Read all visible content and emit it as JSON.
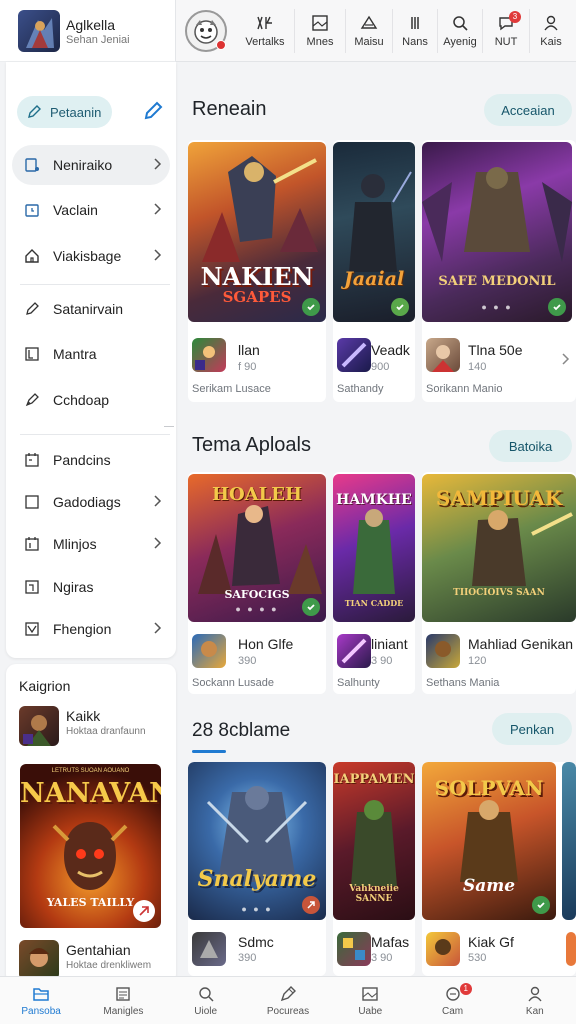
{
  "app": {
    "name": "Aglkella",
    "subtitle": "Sehan Jeniai"
  },
  "topbar": {
    "items": [
      {
        "label": "Vertalks",
        "icon": "bar-chart-icon"
      },
      {
        "label": "Mnes",
        "icon": "image-icon"
      },
      {
        "label": "Maisu",
        "icon": "triangle-icon"
      },
      {
        "label": "Nans",
        "icon": "columns-icon"
      },
      {
        "label": "Ayenig",
        "icon": "search-icon"
      },
      {
        "label": "NUT",
        "icon": "chat-icon",
        "badge": "3"
      },
      {
        "label": "Kais",
        "icon": "user-icon"
      }
    ]
  },
  "sidebar": {
    "action": {
      "label": "Petaanin",
      "icon": "edit-icon"
    },
    "edit_icon": "pencil-icon",
    "items": [
      {
        "label": "Neniraiko",
        "icon": "device-icon",
        "chevron": true
      },
      {
        "label": "Vaclain",
        "icon": "clock-icon",
        "chevron": true
      },
      {
        "label": "Viakisbage",
        "icon": "home-icon",
        "chevron": true
      },
      {
        "label": "Satanirvain",
        "icon": "edit-icon",
        "chevron": false
      },
      {
        "label": "Mantra",
        "icon": "bracket-icon",
        "chevron": false
      },
      {
        "label": "Cchdoap",
        "icon": "pen-icon",
        "chevron": false
      },
      {
        "label": "Pandcins",
        "icon": "calendar-icon",
        "chevron": false
      },
      {
        "label": "Gadodiags",
        "icon": "square-icon",
        "chevron": true
      },
      {
        "label": "Mlinjos",
        "icon": "calendar-icon",
        "chevron": true
      },
      {
        "label": "Ngiras",
        "icon": "note-icon",
        "chevron": false
      },
      {
        "label": "Fhengion",
        "icon": "checkbox-icon",
        "chevron": true
      }
    ]
  },
  "sidebar2": {
    "title": "Kaigrion",
    "items": [
      {
        "name": "Kaikk",
        "sub": "Hoktaa dranfaunn"
      },
      {
        "name": "Gentahian",
        "sub": "Hoktae drenkliwem"
      }
    ],
    "poster": {
      "title": "NANAVAN",
      "subtitle": "YALES TAILLY",
      "banner": "LETRUTS SUOAN AOUANO"
    }
  },
  "sections": [
    {
      "title": "Reneain",
      "action": "Acceaian",
      "cards": [
        {
          "art_title": "NAKIEN",
          "art_subtitle": "SGAPES",
          "name": "llan",
          "sub": "f 90",
          "footer": "Serikam Lusace"
        },
        {
          "art_title": "Jaaial",
          "art_subtitle": "",
          "name": "Veadk",
          "sub": "900",
          "footer": "Sathandy"
        },
        {
          "art_title": "SAFE MEDONIL",
          "art_subtitle": "",
          "name": "Tlna 50e",
          "sub": "140",
          "footer": "Sorikann Manio"
        }
      ]
    },
    {
      "title": "Tema Aploals",
      "action": "Batoika",
      "cards": [
        {
          "art_title": "HOALEH",
          "art_subtitle": "SAFOCIGS",
          "name": "Hon Glfe",
          "sub": "390",
          "footer": "Sockann Lusade"
        },
        {
          "art_title": "HAMKHE",
          "art_subtitle": "TIAN CADDE",
          "name": "liniant",
          "sub": "3 90",
          "footer": "Salhunty"
        },
        {
          "art_title": "SAMPIUAK",
          "art_subtitle": "TIIOCIOIVS SAAN",
          "name": "Mahliad Genikan",
          "sub": "120",
          "footer": "Sethans Mania"
        }
      ]
    },
    {
      "title": "28 8cblame",
      "action": "Penkan",
      "cards": [
        {
          "art_title": "Snalyame",
          "art_subtitle": "",
          "name": "Sdmc",
          "sub": "390",
          "footer": ""
        },
        {
          "art_title": "IAPPAMEN",
          "art_subtitle": "Vahkneiie SANNE",
          "name": "Mafas",
          "sub": "3 90",
          "footer": ""
        },
        {
          "art_title": "SOLPVAN",
          "art_subtitle": "Same",
          "name": "Kiak Gf",
          "sub": "530",
          "footer": ""
        }
      ]
    }
  ],
  "bottomnav": {
    "items": [
      {
        "label": "Pansoba",
        "icon": "folder-icon",
        "active": true
      },
      {
        "label": "Manigles",
        "icon": "gallery-icon"
      },
      {
        "label": "Uiole",
        "icon": "search-icon"
      },
      {
        "label": "Pocureas",
        "icon": "tag-icon"
      },
      {
        "label": "Uabe",
        "icon": "image-icon"
      },
      {
        "label": "Cam",
        "icon": "chat-icon",
        "badge": "1"
      },
      {
        "label": "Kan",
        "icon": "user-icon"
      }
    ]
  },
  "colors": {
    "accent": "#1f7ad1",
    "pill": "#dfeff0",
    "check": "#3f9a4a",
    "badge": "#e03a3a"
  }
}
